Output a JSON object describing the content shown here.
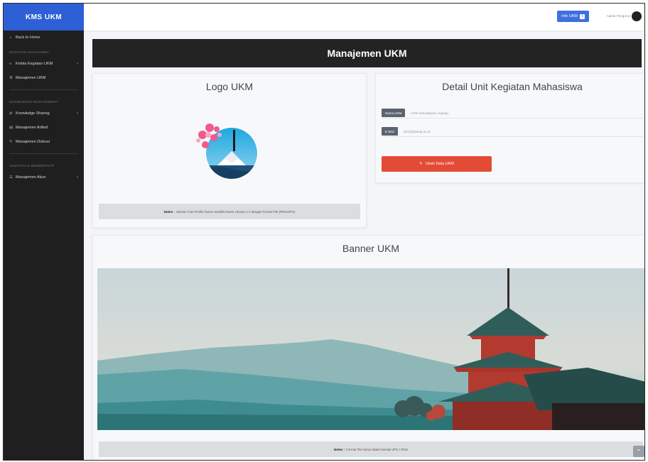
{
  "sidebar": {
    "brand": "KMS UKM",
    "items": [
      {
        "type": "item",
        "label": "Back to Home",
        "icon": "home-icon",
        "glyph": "⌂",
        "chevron": false
      },
      {
        "type": "section",
        "label": "KEGIATAN MAHASISWA"
      },
      {
        "type": "item",
        "label": "Kelola Kegiatan UKM",
        "icon": "list-icon",
        "glyph": "≡",
        "chevron": true
      },
      {
        "type": "item",
        "label": "Manajemen UKM",
        "icon": "gear-icon",
        "glyph": "⚙",
        "chevron": false
      },
      {
        "type": "divider"
      },
      {
        "type": "section",
        "label": "KNOWLEDGE MANAGEMENT"
      },
      {
        "type": "item",
        "label": "Knowledge Sharing",
        "icon": "share-icon",
        "glyph": "⇄",
        "chevron": true
      },
      {
        "type": "item",
        "label": "Manajemen Artikel",
        "icon": "file-icon",
        "glyph": "▤",
        "chevron": false
      },
      {
        "type": "item",
        "label": "Manajemen Diskusi",
        "icon": "chat-icon",
        "glyph": "✎",
        "chevron": false
      },
      {
        "type": "divider"
      },
      {
        "type": "section",
        "label": "ANGGOTA & MEMBERSHIP"
      },
      {
        "type": "item",
        "label": "Manajemen Akun",
        "icon": "users-icon",
        "glyph": "☰",
        "chevron": true
      }
    ]
  },
  "topbar": {
    "info_button": "Info UKM",
    "user_name": "Admin Pengurus"
  },
  "page": {
    "title": "Manajemen UKM",
    "logo_card": {
      "title": "Logo UKM",
      "note_label": "Notes :",
      "note_text": "Ukuran Foto Profile harus memiliki Rasio Ukuran 1:1 dengan format File (PNG/JPG)"
    },
    "detail_card": {
      "title": "Detail Unit Kegiatan Mahasiswa",
      "fields": [
        {
          "label": "Nama UKM",
          "value": "UKM Kebudayaan Jepang"
        },
        {
          "label": "E-Mail",
          "value": "ukm@jepang.ac.id"
        }
      ],
      "edit_button": "Ubah Data UKM"
    },
    "banner_card": {
      "title": "Banner UKM",
      "note_label": "Notes :",
      "note_text": "Format File harus dalam bentuk JPG / PNG"
    }
  },
  "colors": {
    "sidebar_bg": "#1f1f1f",
    "brand_bg": "#2f5fd6",
    "title_bar": "#232323",
    "edit_button": "#e34b37",
    "info_button": "#3d6fe0"
  }
}
